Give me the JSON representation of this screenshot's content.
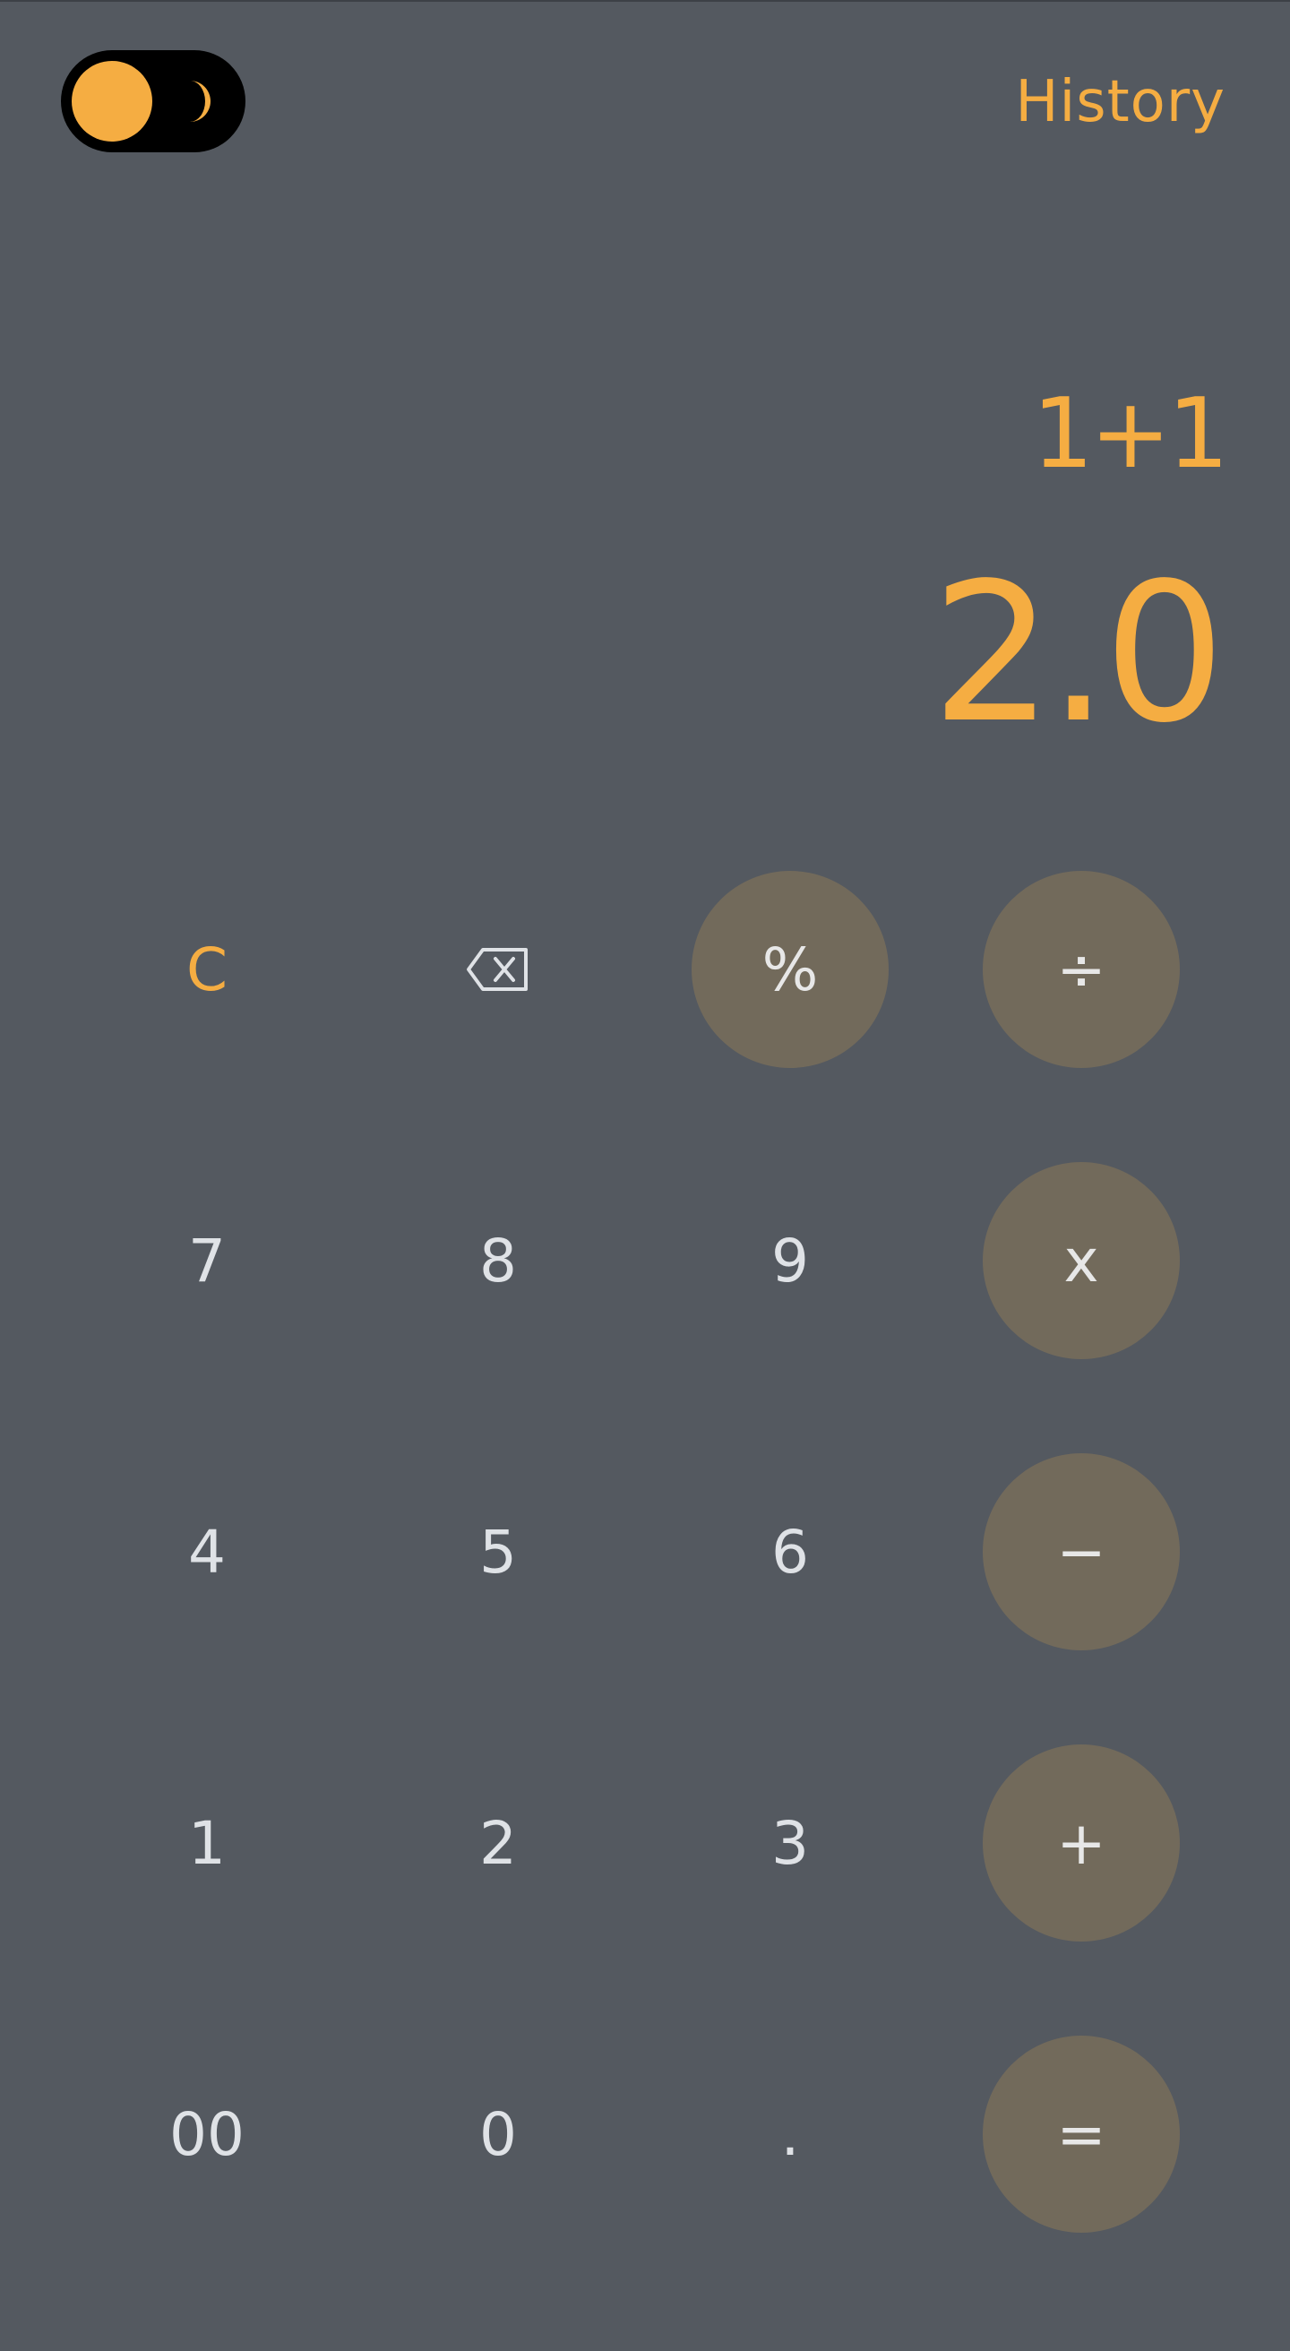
{
  "colors": {
    "background": "#545960",
    "accent": "#f5ad42",
    "operator_bg": "#726a5b",
    "key_text": "#dfe2e6",
    "toggle_bg": "#000000"
  },
  "header": {
    "theme_toggle": {
      "knob_icon": "sun-circle-icon",
      "moon_icon": "moon-icon"
    },
    "history_label": "History"
  },
  "display": {
    "expression": "1+1",
    "result": "2.0"
  },
  "keypad": {
    "row1": [
      {
        "label": "C"
      },
      {
        "label": "",
        "icon": "backspace-icon"
      },
      {
        "label": "%"
      },
      {
        "label": "÷"
      }
    ],
    "row2": [
      {
        "label": "7"
      },
      {
        "label": "8"
      },
      {
        "label": "9"
      },
      {
        "label": "x"
      }
    ],
    "row3": [
      {
        "label": "4"
      },
      {
        "label": "5"
      },
      {
        "label": "6"
      },
      {
        "label": "−"
      }
    ],
    "row4": [
      {
        "label": "1"
      },
      {
        "label": "2"
      },
      {
        "label": "3"
      },
      {
        "label": "+"
      }
    ],
    "row5": [
      {
        "label": "00"
      },
      {
        "label": "0"
      },
      {
        "label": "."
      },
      {
        "label": "="
      }
    ]
  }
}
